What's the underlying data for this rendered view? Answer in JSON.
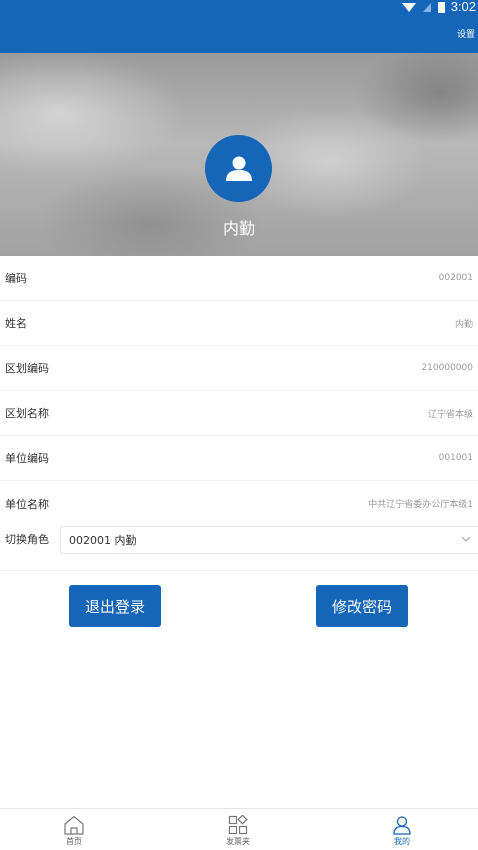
{
  "status": {
    "time": "3:02"
  },
  "header": {
    "settings_label": "设置"
  },
  "profile": {
    "name": "内勤"
  },
  "info": [
    {
      "label": "编码",
      "value": "002001"
    },
    {
      "label": "姓名",
      "value": "内勤"
    },
    {
      "label": "区划编码",
      "value": "210000000"
    },
    {
      "label": "区划名称",
      "value": "辽宁省本级"
    },
    {
      "label": "单位编码",
      "value": "001001"
    },
    {
      "label": "单位名称",
      "value": "中共辽宁省委办公厅本级1"
    }
  ],
  "role": {
    "label": "切换角色",
    "selected": "002001 内勤"
  },
  "actions": {
    "logout_label": "退出登录",
    "change_password_label": "修改密码"
  },
  "tabs": [
    {
      "label": "首页",
      "icon": "home-icon"
    },
    {
      "label": "发票夹",
      "icon": "grid-icon"
    },
    {
      "label": "我的",
      "icon": "user-icon"
    }
  ],
  "colors": {
    "primary": "#1565b8",
    "muted": "#9a9a9a"
  }
}
